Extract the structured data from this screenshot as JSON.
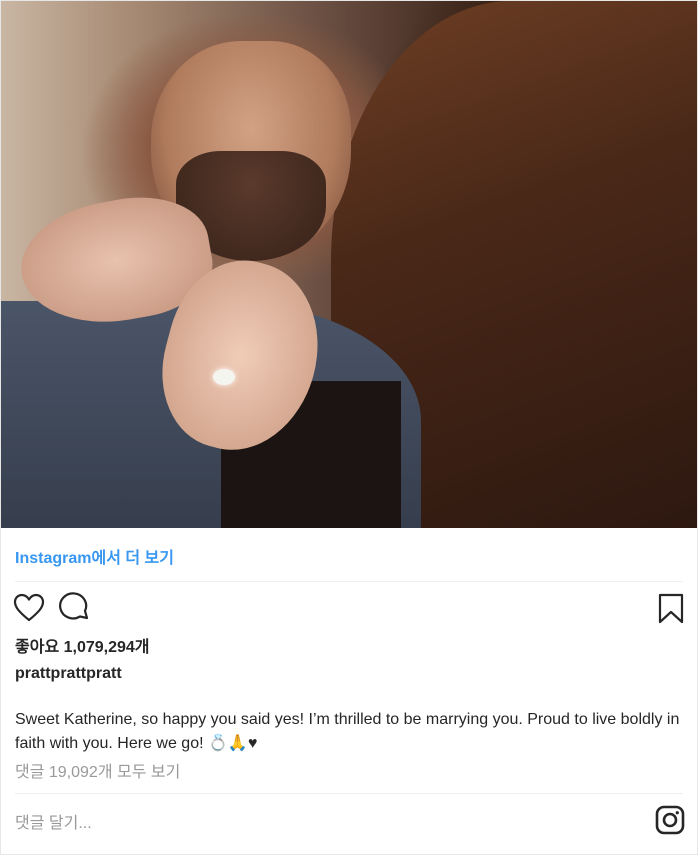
{
  "photo": {
    "alt_icon": "couple-photo"
  },
  "more_link": "Instagram에서 더 보기",
  "actions": {
    "like_icon": "heart-icon",
    "comment_icon": "comment-icon",
    "save_icon": "bookmark-icon"
  },
  "likes": {
    "label": "좋아요",
    "count": "1,079,294개"
  },
  "post": {
    "username": "prattprattpratt",
    "caption_text": "Sweet Katherine, so happy you said yes! I’m thrilled to be marrying you. Proud to live boldly in faith with you. Here we go!",
    "caption_emoji": "💍🙏♥"
  },
  "comments_link": "댓글 19,092개 모두 보기",
  "comment_placeholder": "댓글 달기...",
  "footer": {
    "logo_icon": "instagram-icon"
  }
}
